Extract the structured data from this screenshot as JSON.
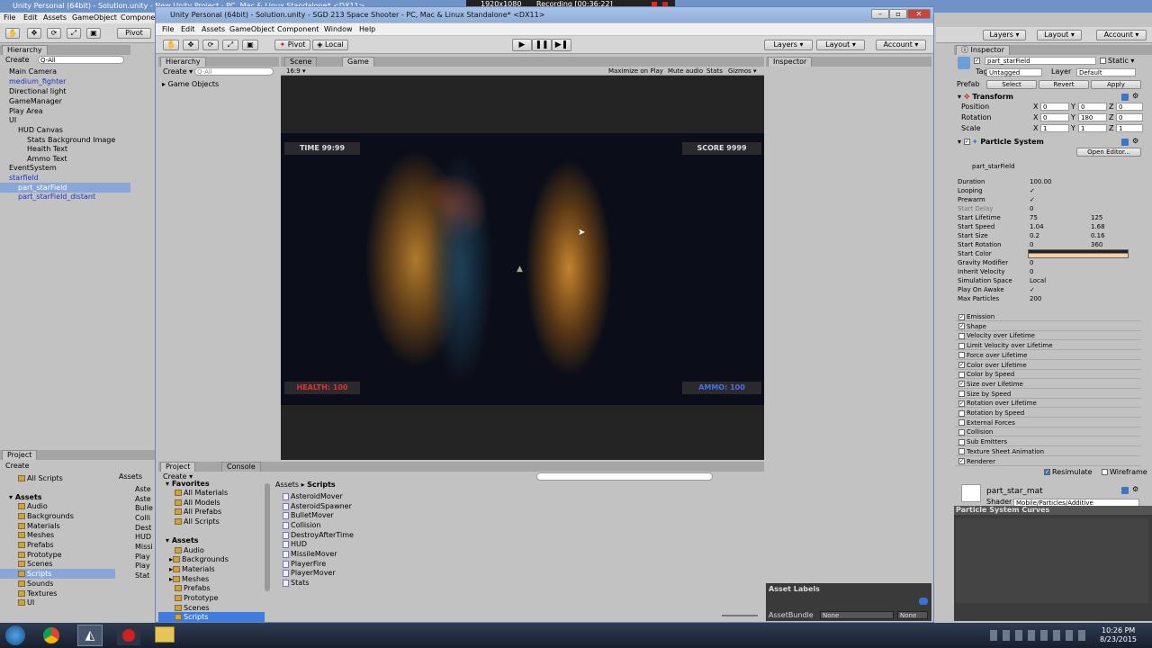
{
  "back_window": {
    "title": "Unity Personal (64bit) - Solution.unity - New Unity Project - PC, Mac & Linux Standalone* <DX11>",
    "menu": [
      "File",
      "Edit",
      "Assets",
      "GameObject",
      "Component"
    ],
    "pivot": "Pivot",
    "hierarchy": {
      "tab": "Hierarchy",
      "create": "Create",
      "search": "Q-All",
      "items": [
        "Main Camera",
        "medium_fighter",
        "Directional light",
        "GameManager",
        "Play Area",
        "UI",
        "HUD Canvas",
        "Stats Background Image",
        "Health Text",
        "Ammo Text",
        "EventSystem",
        "starfield",
        "part_starField",
        "part_starField_distant"
      ]
    },
    "project": {
      "tab": "Project",
      "create": "Create",
      "items": [
        "All Scripts",
        "Assets",
        "Audio",
        "Backgrounds",
        "Materials",
        "Meshes",
        "Prefabs",
        "Prototype",
        "Scenes",
        "Scripts",
        "Sounds",
        "Textures",
        "UI"
      ],
      "assets_label": "Assets",
      "file_stubs": [
        "Aste",
        "Aste",
        "Bulle",
        "Colli",
        "Dest",
        "HUD",
        "Missi",
        "Play",
        "Play",
        "Stat"
      ]
    }
  },
  "recorder": {
    "resolution": "1920x1080",
    "status": "Recording [00:36:22]"
  },
  "window": {
    "title": "Unity Personal (64bit) - Solution.unity - SGD 213 Space Shooter - PC, Mac & Linux Standalone* <DX11>",
    "menu": [
      "File",
      "Edit",
      "Assets",
      "GameObject",
      "Component",
      "Window",
      "Help"
    ],
    "toolbar": {
      "pivot": "Pivot",
      "local": "Local",
      "layers": "Layers",
      "layout": "Layout",
      "account": "Account"
    },
    "hierarchy": {
      "tab": "Hierarchy",
      "create": "Create",
      "search": "Q-All",
      "root": "Game Objects"
    },
    "game_view": {
      "scene_tab": "Scene",
      "game_tab": "Game",
      "aspect": "16:9",
      "options": [
        "Maximize on Play",
        "Mute audio",
        "Stats",
        "Gizmos"
      ],
      "hud": {
        "time": "TIME 99:99",
        "score": "SCORE 9999",
        "health": "HEALTH: 100",
        "ammo": "AMMO: 100"
      }
    },
    "inspector_tab": "Inspector",
    "project": {
      "tab": "Project",
      "console_tab": "Console",
      "create": "Create",
      "favorites_label": "Favorites",
      "favorites": [
        "All Materials",
        "All Models",
        "All Prefabs",
        "All Scripts"
      ],
      "assets_label": "Assets",
      "folders": [
        "Audio",
        "Backgrounds",
        "Materials",
        "Meshes",
        "Prefabs",
        "Prototype",
        "Scenes",
        "Scripts"
      ],
      "breadcrumb": [
        "Assets",
        "Scripts"
      ],
      "scripts": [
        "AsteroidMover",
        "AsteroidSpawner",
        "BulletMover",
        "Collision",
        "DestroyAfterTime",
        "HUD",
        "MissileMover",
        "PlayerFire",
        "PlayerMover",
        "Stats"
      ]
    },
    "asset_labels": {
      "title": "Asset Labels",
      "bundle_label": "AssetBundle",
      "bundle_value": "None",
      "variant_value": "None"
    }
  },
  "right_top": {
    "layers": "Layers",
    "layout": "Layout",
    "account": "Account"
  },
  "inspector": {
    "tab": "Inspector",
    "object_name": "part_starField",
    "static": "Static",
    "tag_label": "Tag",
    "tag_value": "Untagged",
    "layer_label": "Layer",
    "layer_value": "Default",
    "prefab_label": "Prefab",
    "prefab_buttons": [
      "Select",
      "Revert",
      "Apply"
    ],
    "transform": {
      "title": "Transform",
      "rows": [
        {
          "label": "Position",
          "x": "0",
          "y": "0",
          "z": "0"
        },
        {
          "label": "Rotation",
          "x": "0",
          "y": "180",
          "z": "0"
        },
        {
          "label": "Scale",
          "x": "1",
          "y": "1",
          "z": "1"
        }
      ]
    },
    "particle_system": {
      "title": "Particle System",
      "open_editor": "Open Editor...",
      "subtitle": "part_starField",
      "fields": [
        {
          "label": "Duration",
          "v1": "100.00",
          "v2": ""
        },
        {
          "label": "Looping",
          "v1": "✓",
          "v2": ""
        },
        {
          "label": "Prewarm",
          "v1": "✓",
          "v2": ""
        },
        {
          "label": "Start Delay",
          "v1": "0",
          "v2": ""
        },
        {
          "label": "Start Lifetime",
          "v1": "75",
          "v2": "125"
        },
        {
          "label": "Start Speed",
          "v1": "1.04",
          "v2": "1.68"
        },
        {
          "label": "Start Size",
          "v1": "0.2",
          "v2": "0.16"
        },
        {
          "label": "Start Rotation",
          "v1": "0",
          "v2": "360"
        },
        {
          "label": "Start Color",
          "v1": "",
          "v2": ""
        },
        {
          "label": "Gravity Modifier",
          "v1": "0",
          "v2": ""
        },
        {
          "label": "Inherit Velocity",
          "v1": "0",
          "v2": ""
        },
        {
          "label": "Simulation Space",
          "v1": "Local",
          "v2": ""
        },
        {
          "label": "Play On Awake",
          "v1": "✓",
          "v2": ""
        },
        {
          "label": "Max Particles",
          "v1": "200",
          "v2": ""
        }
      ],
      "modules": [
        {
          "label": "Emission",
          "checked": true
        },
        {
          "label": "Shape",
          "checked": true
        },
        {
          "label": "Velocity over Lifetime",
          "checked": false
        },
        {
          "label": "Limit Velocity over Lifetime",
          "checked": false
        },
        {
          "label": "Force over Lifetime",
          "checked": false
        },
        {
          "label": "Color over Lifetime",
          "checked": true
        },
        {
          "label": "Color by Speed",
          "checked": false
        },
        {
          "label": "Size over Lifetime",
          "checked": true
        },
        {
          "label": "Size by Speed",
          "checked": false
        },
        {
          "label": "Rotation over Lifetime",
          "checked": true
        },
        {
          "label": "Rotation by Speed",
          "checked": false
        },
        {
          "label": "External Forces",
          "checked": false
        },
        {
          "label": "Collision",
          "checked": false
        },
        {
          "label": "Sub Emitters",
          "checked": false
        },
        {
          "label": "Texture Sheet Animation",
          "checked": false
        },
        {
          "label": "Renderer",
          "checked": true
        }
      ],
      "resimulate": "Resimulate",
      "wireframe": "Wireframe"
    },
    "material": {
      "name": "part_star_mat",
      "shader_label": "Shader",
      "shader_value": "Mobile/Particles/Additive"
    },
    "curves_title": "Particle System Curves"
  },
  "taskbar": {
    "time": "10:26 PM",
    "date": "8/23/2015"
  }
}
